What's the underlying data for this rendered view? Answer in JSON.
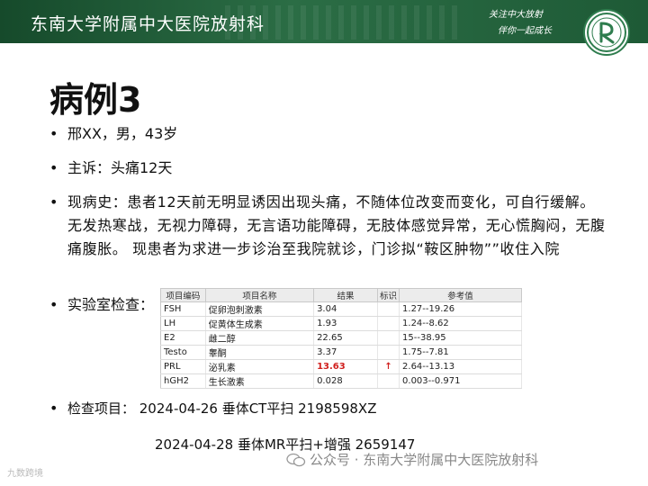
{
  "header": {
    "title": "东南大学附属中大医院放射科",
    "slogan_line1": "关注中大放射",
    "slogan_line2": "伴你一起成长",
    "brand_color": "#1f5a36"
  },
  "slide": {
    "title": "病例3",
    "bullets": [
      {
        "text": "邢XX，男，43岁"
      },
      {
        "text": "主诉：头痛12天"
      },
      {
        "text": "现病史：患者12天前无明显诱因出现头痛，不随体位改变而变化，可自行缓解。无发热寒战，无视力障碍，无言语功能障碍，无肢体感觉异常，无心慌胸闷，无腹痛腹胀。 现患者为求进一步诊治至我院就诊，门诊拟“鞍区肿物””收住入院"
      },
      {
        "text": "实验室检查："
      },
      {
        "text": "检查项目： 2024-04-26 垂体CT平扫 2198598XZ"
      }
    ],
    "exam_line2": "2024-04-28  垂体MR平扫+增强   2659147"
  },
  "lab_table": {
    "headers": [
      "项目编码",
      "项目名称",
      "结果",
      "标识",
      "参考值"
    ],
    "rows": [
      {
        "code": "FSH",
        "name": "促卵泡刺激素",
        "result": "3.04",
        "flag": "",
        "ref": "1.27--19.26"
      },
      {
        "code": "LH",
        "name": "促黄体生成素",
        "result": "1.93",
        "flag": "",
        "ref": "1.24--8.62"
      },
      {
        "code": "E2",
        "name": "雌二醇",
        "result": "22.65",
        "flag": "",
        "ref": "15--38.95"
      },
      {
        "code": "Testo",
        "name": "睾酮",
        "result": "3.37",
        "flag": "",
        "ref": "1.75--7.81"
      },
      {
        "code": "PRL",
        "name": "泌乳素",
        "result": "13.63",
        "flag": "↑",
        "ref": "2.64--13.13",
        "abnormal": true
      },
      {
        "code": "hGH2",
        "name": "生长激素",
        "result": "0.028",
        "flag": "",
        "ref": "0.003--0.971"
      }
    ],
    "abnormal_color": "#d0201e"
  },
  "watermark": {
    "text": "公众号 · 东南大学附属中大医院放射科",
    "icon": "wechat-icon"
  },
  "corner_mark": "九数跨境"
}
